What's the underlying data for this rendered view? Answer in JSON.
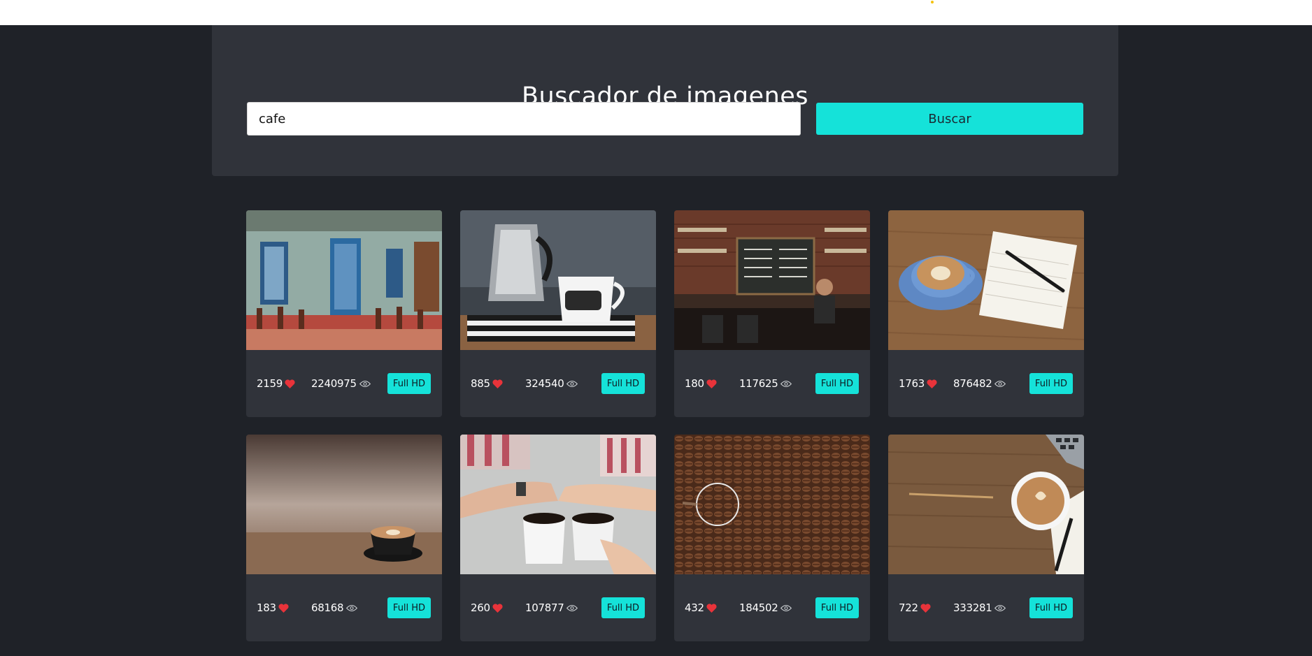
{
  "header": {
    "title": "Buscador de imagenes"
  },
  "search": {
    "value": "cafe",
    "button_label": "Buscar"
  },
  "colors": {
    "accent": "#15e2d9",
    "heart": "#e8333a",
    "panel": "#30333a",
    "background": "#1f2228"
  },
  "results": [
    {
      "likes": "2159",
      "views": "2240975",
      "download_label": "Full HD",
      "image": "cafe-street-facade"
    },
    {
      "likes": "885",
      "views": "324540",
      "download_label": "Full HD",
      "image": "coffee-mug-and-moka-pot"
    },
    {
      "likes": "180",
      "views": "117625",
      "download_label": "Full HD",
      "image": "coffee-shop-counter"
    },
    {
      "likes": "1763",
      "views": "876482",
      "download_label": "Full HD",
      "image": "latte-and-notebook"
    },
    {
      "likes": "183",
      "views": "68168",
      "download_label": "Full HD",
      "image": "latte-cup-on-table"
    },
    {
      "likes": "260",
      "views": "107877",
      "download_label": "Full HD",
      "image": "two-coffee-cups-holding-hands"
    },
    {
      "likes": "432",
      "views": "184502",
      "download_label": "Full HD",
      "image": "coffee-beans"
    },
    {
      "likes": "722",
      "views": "333281",
      "download_label": "Full HD",
      "image": "latte-on-wooden-desk"
    }
  ]
}
